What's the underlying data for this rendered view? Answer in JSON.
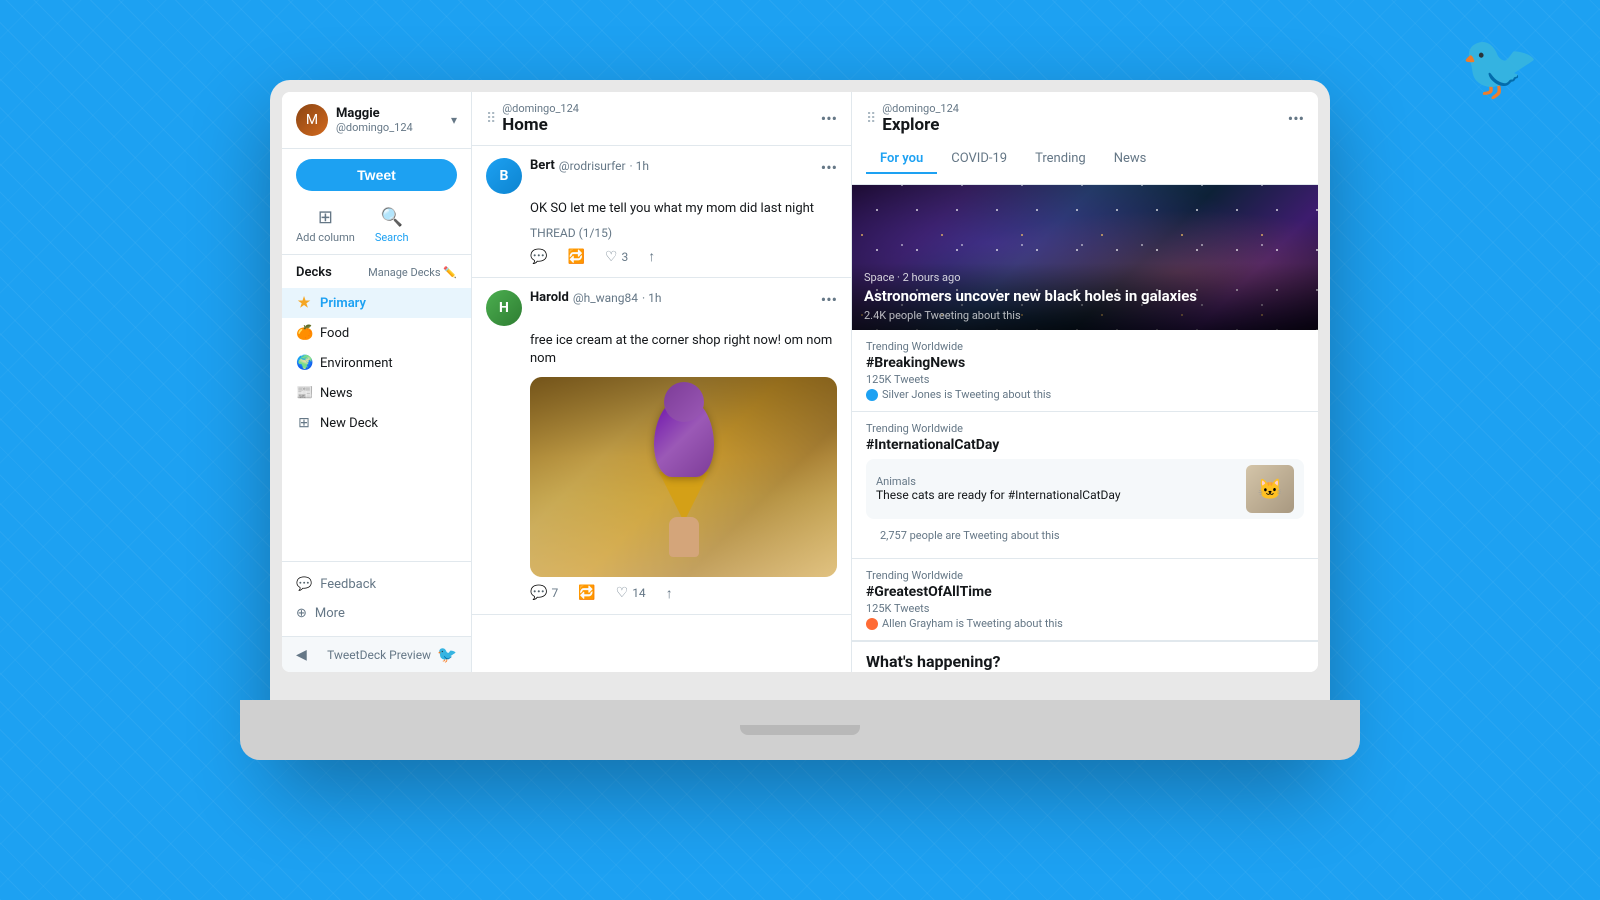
{
  "app": {
    "name": "TweetDeck",
    "twitter_bird_icon": "🐦"
  },
  "user": {
    "display_name": "Maggie",
    "handle": "@domingo_124",
    "avatar_initial": "M"
  },
  "sidebar": {
    "tweet_button": "Tweet",
    "add_column_label": "Add column",
    "search_label": "Search",
    "decks_title": "Decks",
    "manage_decks_label": "Manage Decks",
    "deck_items": [
      {
        "id": "primary",
        "label": "Primary",
        "icon": "★",
        "icon_class": "star",
        "active": true
      },
      {
        "id": "food",
        "label": "Food",
        "icon": "🍊",
        "icon_class": "food"
      },
      {
        "id": "environment",
        "label": "Environment",
        "icon": "🌍",
        "icon_class": "env"
      },
      {
        "id": "news",
        "label": "News",
        "icon": "📰",
        "icon_class": "news"
      },
      {
        "id": "new-deck",
        "label": "New Deck",
        "icon": "⊞",
        "icon_class": "new"
      }
    ],
    "footer_items": [
      {
        "label": "Feedback",
        "icon": "💬"
      },
      {
        "label": "More",
        "icon": "⊕"
      }
    ],
    "preview_label": "TweetDeck Preview"
  },
  "home_column": {
    "username": "@domingo_124",
    "title": "Home",
    "tweets": [
      {
        "id": "tweet1",
        "user_display_name": "Bert",
        "user_handle": "@rodrisurfer",
        "time": "1h",
        "body": "OK SO let me tell you what my mom did last night",
        "thread_label": "THREAD (1/15)",
        "replies": null,
        "retweets": null,
        "likes": "3",
        "has_image": false,
        "avatar_initial": "B",
        "avatar_class": "bert"
      },
      {
        "id": "tweet2",
        "user_display_name": "Harold",
        "user_handle": "@h_wang84",
        "time": "1h",
        "body": "free ice cream at the corner shop right now! om nom nom",
        "thread_label": null,
        "replies": "7",
        "retweets": null,
        "likes": "14",
        "has_image": true,
        "avatar_initial": "H",
        "avatar_class": "harold"
      }
    ]
  },
  "explore_column": {
    "username": "@domingo_124",
    "title": "Explore",
    "tabs": [
      {
        "id": "for-you",
        "label": "For you",
        "active": true
      },
      {
        "id": "covid-19",
        "label": "COVID-19",
        "active": false
      },
      {
        "id": "trending",
        "label": "Trending",
        "active": false
      },
      {
        "id": "news",
        "label": "News",
        "active": false
      }
    ],
    "news_hero": {
      "category": "Space · 2 hours ago",
      "title": "Astronomers uncover new black holes in galaxies",
      "count": "2.4K people Tweeting about this"
    },
    "trending_items": [
      {
        "id": "breaking",
        "label": "Trending Worldwide",
        "hashtag": "#BreakingNews",
        "tweets": "125K Tweets",
        "author": "Silver Jones is Tweeting about this",
        "author_dot_class": "blue",
        "sub_card": null
      },
      {
        "id": "catday",
        "label": "Trending Worldwide",
        "hashtag": "#InternationalCatDay",
        "tweets": null,
        "author": null,
        "author_dot_class": null,
        "sub_card": {
          "category": "Animals",
          "title": "These cats are ready for #InternationalCatDay",
          "image_emoji": "🐱",
          "count": "2,757 people are Tweeting about this"
        }
      },
      {
        "id": "goat",
        "label": "Trending Worldwide",
        "hashtag": "#GreatestOfAllTime",
        "tweets": "125K Tweets",
        "author": "Allen Grayham is Tweeting about this",
        "author_dot_class": "orange",
        "sub_card": null
      }
    ],
    "whats_happening": "What's happening?"
  }
}
